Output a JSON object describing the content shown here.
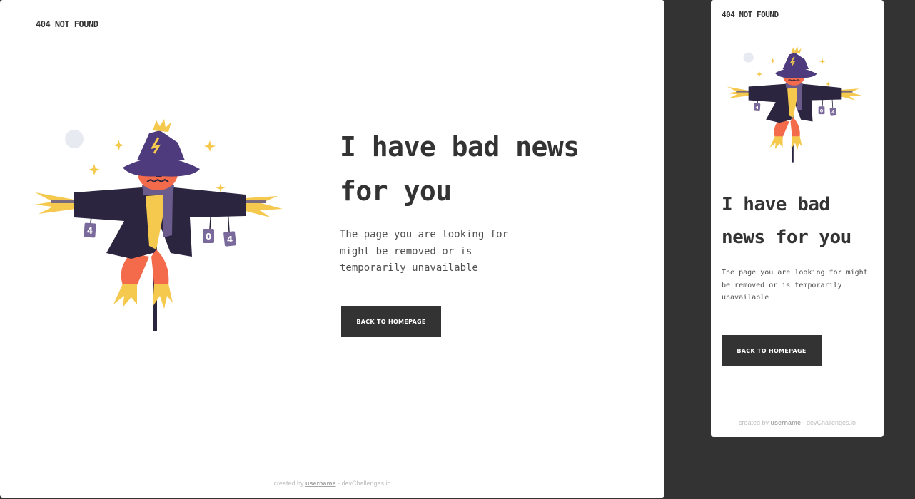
{
  "brand": "404 NOT FOUND",
  "headline": "I have bad news for you",
  "description": "The page you are looking for might be removed or is temporarily unavailable",
  "button_label": "BACK TO HOMEPAGE",
  "footer": {
    "prefix": "created by ",
    "username": "username",
    "suffix": " - devChallenges.io"
  },
  "illustration": {
    "icon": "scarecrow-illustration",
    "can_labels": [
      "4",
      "0",
      "4"
    ]
  },
  "colors": {
    "background": "#333333",
    "panel": "#ffffff",
    "text": "#333333",
    "button": "#333333"
  }
}
